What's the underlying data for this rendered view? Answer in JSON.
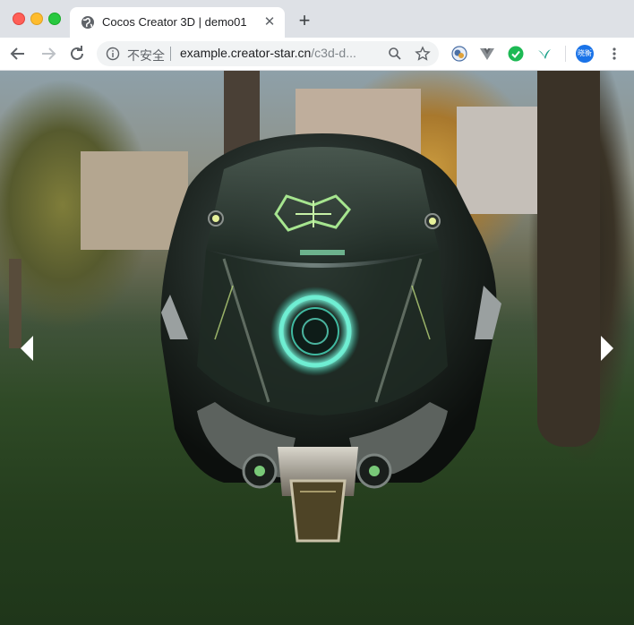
{
  "browser": {
    "tab": {
      "title": "Cocos Creator 3D | demo01"
    },
    "omnibox": {
      "security_label": "不安全",
      "url_host": "example.creator-star.cn",
      "url_path": "/c3d-d..."
    },
    "profile_label": "晓衡"
  },
  "viewport": {
    "scene_name": "helmet-3d-model",
    "prev_arrow": "previous",
    "next_arrow": "next"
  },
  "colors": {
    "accent_glow": "#52e3c8",
    "tab_strip": "#dee1e6",
    "toolbar": "#ffffff"
  }
}
